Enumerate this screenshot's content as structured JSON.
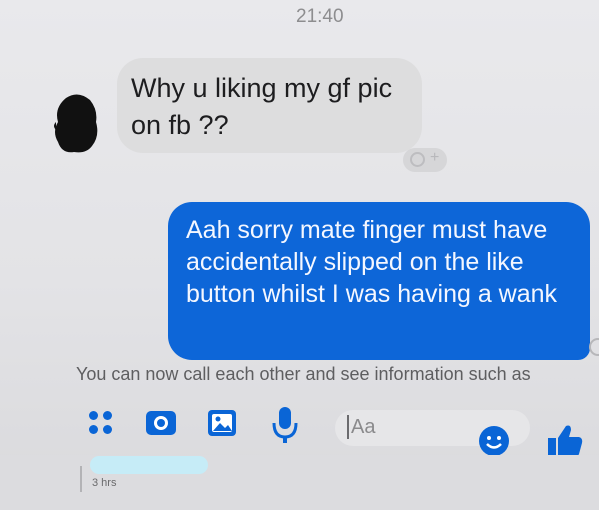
{
  "header": {
    "time": "21:40"
  },
  "messages": {
    "incoming": {
      "text": "Why u liking my gf pic on fb ??"
    },
    "outgoing": {
      "text": "Aah sorry mate finger must have accidentally slipped on the like button whilst I was having a wank"
    }
  },
  "notice": {
    "text": "You can now call each other and see information such as"
  },
  "composer": {
    "placeholder": "Aa",
    "icons": [
      "menu-dots-icon",
      "camera-icon",
      "image-icon",
      "microphone-icon",
      "emoji-icon",
      "thumbs-up-icon"
    ]
  },
  "footer": {
    "timestamp": "3 hrs"
  },
  "colors": {
    "accent": "#0a65d6",
    "outgoing_bubble": "#0d66d8",
    "incoming_bubble": "#ddddde",
    "background": "#e6e6e9"
  }
}
